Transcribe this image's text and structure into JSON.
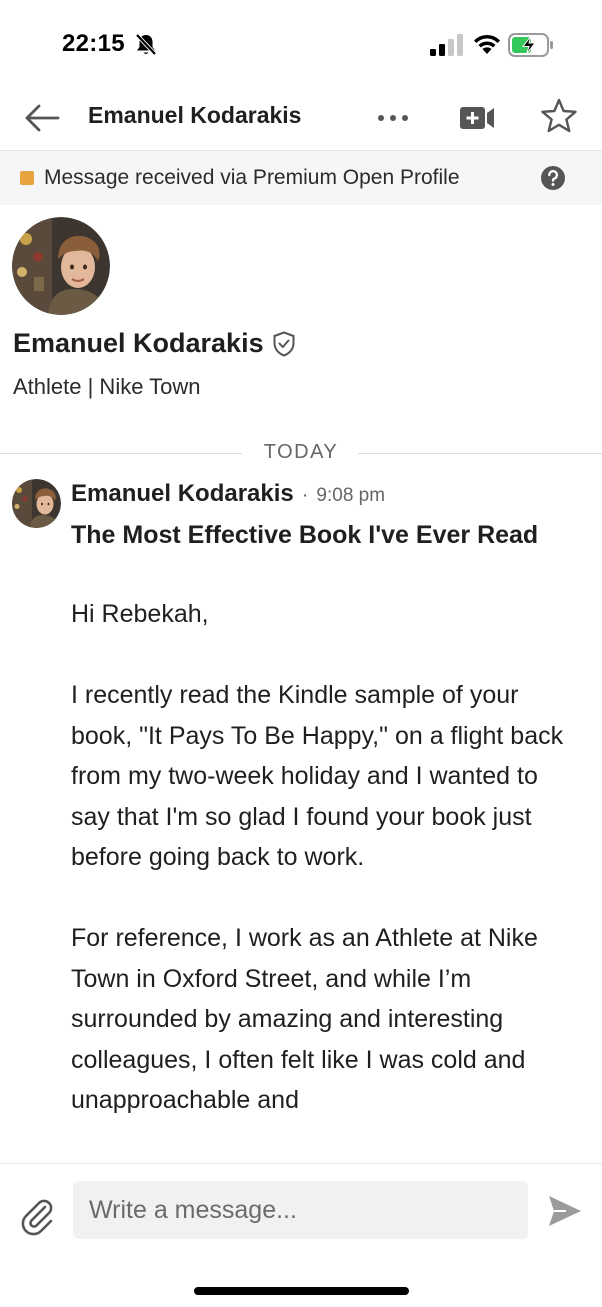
{
  "status_bar": {
    "time": "22:15",
    "icons": [
      "bell-slash-icon",
      "signal-icon",
      "wifi-icon",
      "battery-charging-icon"
    ]
  },
  "header": {
    "title": "Emanuel Kodarakis",
    "icons": [
      "back-arrow-icon",
      "more-icon",
      "video-call-icon",
      "star-icon"
    ]
  },
  "banner": {
    "text": "Message received via Premium Open Profile",
    "icons": [
      "premium-tag-icon",
      "help-icon"
    ],
    "tag_color": "#e7a33e"
  },
  "profile": {
    "name": "Emanuel Kodarakis",
    "headline": "Athlete | Nike Town",
    "icons": [
      "avatar",
      "verified-shield-icon"
    ]
  },
  "divider": {
    "label": "TODAY"
  },
  "message": {
    "sender": "Emanuel Kodarakis",
    "separator": "·",
    "time": "9:08 pm",
    "subject": "The Most Effective Book I've Ever Read",
    "greeting": "Hi Rebekah,",
    "paragraph_1": "I recently read the Kindle sample of your book, \"It Pays To Be Happy,\" on a flight back from my two-week holiday and I wanted to say that I'm so glad I found your book just before going back to work.",
    "paragraph_2": "For reference, I work as an Athlete at Nike Town in Oxford Street, and while I’m surrounded by amazing and interesting colleagues, I often felt like I was cold and unapproachable and"
  },
  "composer": {
    "placeholder": "Write a message...",
    "value": "",
    "icons": [
      "attach-icon",
      "send-icon"
    ]
  },
  "colors": {
    "text": "#1f1f1f",
    "secondary_text": "#666666",
    "banner_background": "#f4f6f8",
    "input_background": "#f1f1ef",
    "battery_green": "#34c759"
  }
}
